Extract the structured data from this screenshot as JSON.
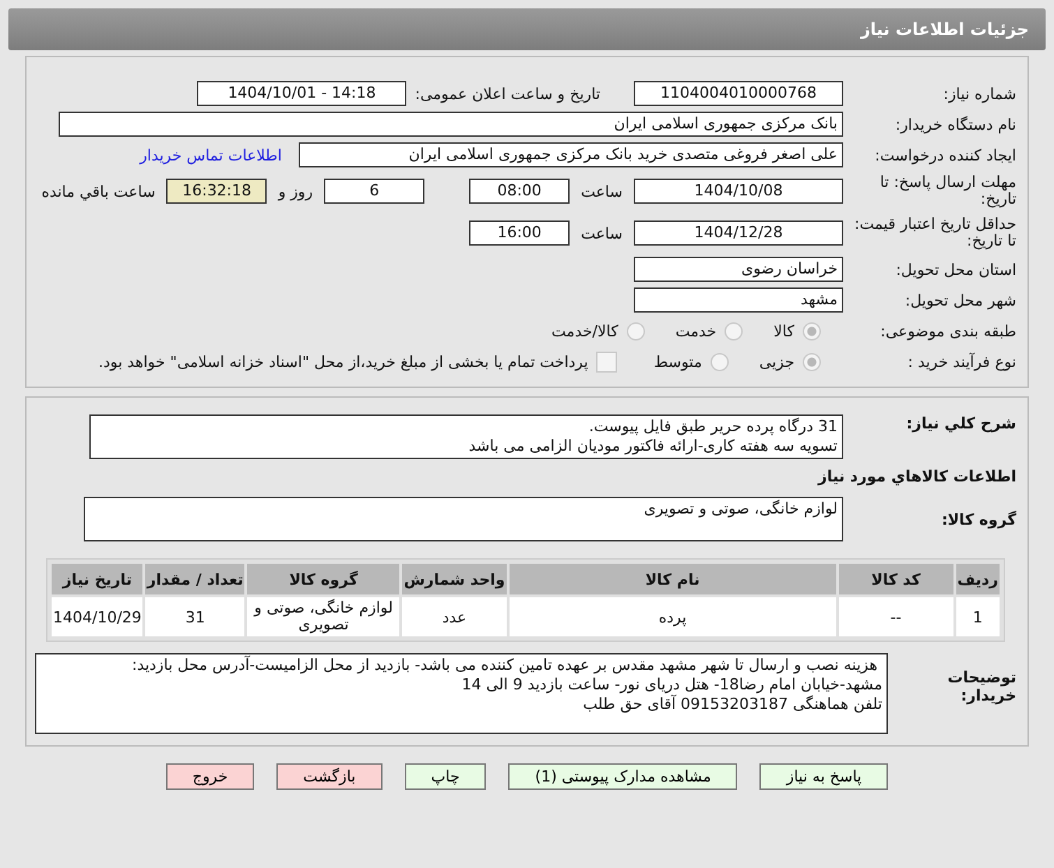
{
  "header": {
    "title": "جزئیات اطلاعات نیاز"
  },
  "need_number": {
    "label": "شماره نیاز:",
    "value": "1104004010000768"
  },
  "announce": {
    "label": "تاریخ و ساعت اعلان عمومی:",
    "value": "1404/10/01 - 14:18"
  },
  "buyer_org": {
    "label": "نام دستگاه خریدار:",
    "value": "بانک مرکزی جمهوری اسلامی ایران"
  },
  "creator": {
    "label": "ایجاد کننده درخواست:",
    "value": "علی اصغر فروغی متصدی خرید بانک مرکزی جمهوری اسلامی ایران",
    "link": "اطلاعات تماس خریدار"
  },
  "deadline": {
    "label": "مهلت ارسال پاسخ: تا تاریخ:",
    "date": "1404/10/08",
    "time_label": "ساعت",
    "time": "08:00",
    "days": "6",
    "days_label": "روز و",
    "remaining": "16:32:18",
    "remaining_label": "ساعت باقي مانده"
  },
  "validity": {
    "label": "حداقل تاریخ اعتبار قیمت: تا تاریخ:",
    "date": "1404/12/28",
    "time_label": "ساعت",
    "time": "16:00"
  },
  "province": {
    "label": "استان محل تحویل:",
    "value": "خراسان رضوی"
  },
  "city": {
    "label": "شهر محل تحویل:",
    "value": "مشهد"
  },
  "category": {
    "label": "طبقه بندی موضوعی:",
    "options": [
      {
        "label": "کالا",
        "selected": true
      },
      {
        "label": "خدمت",
        "selected": false
      },
      {
        "label": "کالا/خدمت",
        "selected": false
      }
    ]
  },
  "purchase_type": {
    "label": "نوع فرآیند خرید :",
    "options": [
      {
        "label": "جزیی",
        "selected": true
      },
      {
        "label": "متوسط",
        "selected": false
      }
    ],
    "treasury": {
      "checked": false,
      "label": "پرداخت تمام یا بخشی از مبلغ خرید،از محل \"اسناد خزانه اسلامی\" خواهد بود."
    }
  },
  "description": {
    "label": "شرح کلي نياز:",
    "lines": [
      "31 درگاه پرده حریر طبق فایل پیوست.",
      "تسویه سه هفته کاری-ارائه فاکتور مودیان الزامی می باشد"
    ]
  },
  "goods_heading": "اطلاعات کالاهاي مورد نياز",
  "goods_group": {
    "label": "گروه کالا:",
    "value": "لوازم خانگی، صوتی و تصویری"
  },
  "table": {
    "columns": [
      "ردیف",
      "کد کالا",
      "نام کالا",
      "واحد شمارش",
      "گروه کالا",
      "تعداد / مقدار",
      "تاریخ نیاز"
    ],
    "rows": [
      [
        "1",
        "--",
        "پرده",
        "عدد",
        "لوازم خانگی، صوتی و تصویری",
        "31",
        "1404/10/29"
      ]
    ]
  },
  "buyer_notes": {
    "label": "توضیحات خریدار:",
    "lines": [
      " هزینه نصب و ارسال تا شهر مشهد مقدس بر عهده تامین کننده می باشد- بازدید از محل الزامیست-آدرس محل بازدید:",
      "مشهد-خیابان امام رضا18- هتل دریای نور- ساعت بازدید 9 الی 14",
      "تلفن هماهنگی 09153203187 آقای حق طلب"
    ]
  },
  "buttons": [
    {
      "label": "پاسخ به نیاز",
      "kind": "green"
    },
    {
      "label": "مشاهده مدارک پیوستی (1)",
      "kind": "green"
    },
    {
      "label": "چاپ",
      "kind": "green"
    },
    {
      "label": "بازگشت",
      "kind": "red"
    },
    {
      "label": "خروج",
      "kind": "red"
    }
  ]
}
